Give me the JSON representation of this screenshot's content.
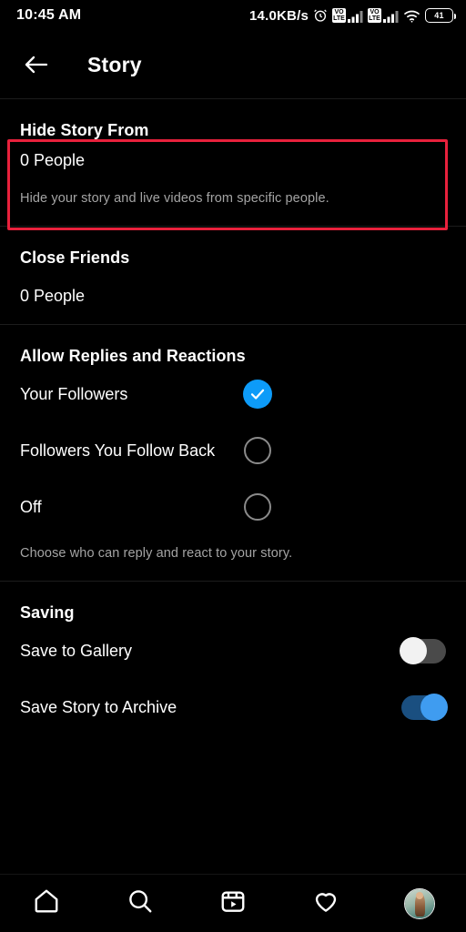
{
  "status_bar": {
    "time": "10:45 AM",
    "network_speed": "14.0KB/s",
    "alarm_icon": "alarm-clock-icon",
    "sim1_volte_label_top": "VO",
    "sim1_volte_label_bottom": "LTE",
    "sim2_volte_label_top": "VO",
    "sim2_volte_label_bottom": "LTE",
    "wifi_icon": "wifi-icon",
    "battery_percent": "41"
  },
  "header": {
    "back_icon": "back-arrow-icon",
    "title": "Story"
  },
  "sections": {
    "hide_story": {
      "heading": "Hide Story From",
      "value": "0 People",
      "caption": "Hide your story and live videos from specific people."
    },
    "close_friends": {
      "heading": "Close Friends",
      "value": "0 People"
    },
    "replies": {
      "heading": "Allow Replies and Reactions",
      "caption": "Choose who can reply and react to your story.",
      "options": [
        {
          "label": "Your Followers",
          "selected": true
        },
        {
          "label": "Followers You Follow Back",
          "selected": false
        },
        {
          "label": "Off",
          "selected": false
        }
      ]
    },
    "saving": {
      "heading": "Saving",
      "toggles": [
        {
          "label": "Save to Gallery",
          "on": false
        },
        {
          "label": "Save Story to Archive",
          "on": true
        }
      ]
    }
  },
  "highlight": {
    "color": "#e8213c",
    "target": "Hide Story From"
  },
  "bottom_nav": {
    "items": [
      {
        "name": "home-icon",
        "label": "Home"
      },
      {
        "name": "search-icon",
        "label": "Search"
      },
      {
        "name": "reels-icon",
        "label": "Reels"
      },
      {
        "name": "heart-icon",
        "label": "Activity"
      },
      {
        "name": "profile-avatar",
        "label": "Profile"
      }
    ]
  },
  "colors": {
    "background": "#000000",
    "primary_text": "#ffffff",
    "secondary_text": "#a4a4a4",
    "accent_blue": "#0d9bf8",
    "toggle_on": "#3f9cf0",
    "divider": "#1c1c1c",
    "highlight_red": "#e8213c"
  }
}
